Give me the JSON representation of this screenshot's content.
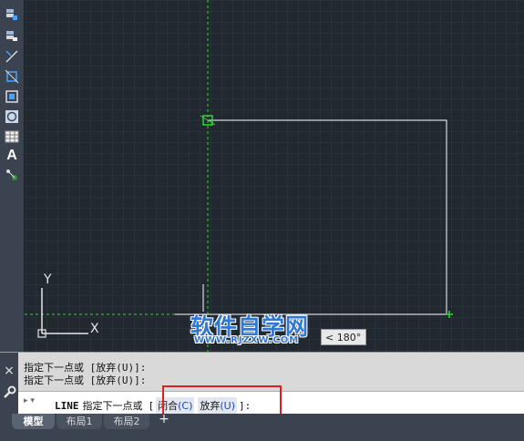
{
  "toolbar": {
    "tools": [
      {
        "icon": "layer-properties-icon"
      },
      {
        "icon": "layer-state-icon"
      },
      {
        "icon": "line-icon"
      },
      {
        "icon": "zoom-extents-icon"
      },
      {
        "icon": "zoom-window-icon"
      },
      {
        "icon": "circle-icon"
      },
      {
        "icon": "table-icon"
      },
      {
        "icon": "text-icon",
        "glyph": "A"
      },
      {
        "icon": "dimension-icon"
      }
    ]
  },
  "canvas": {
    "drawing_color": "#ffffff",
    "snap_color": "#2fd72f",
    "background": "#212830",
    "ucs_icon": "ucs-icon",
    "angle_tooltip": "< 180°"
  },
  "watermark": {
    "main": "软件自学网",
    "sub": "WWW.RJZXW.COM"
  },
  "command": {
    "history": [
      "指定下一点或 [放弃(U)]:",
      "指定下一点或 [放弃(U)]:"
    ],
    "close_icon": "×",
    "prompt_icon": "▸ ▾",
    "current": {
      "command": "LINE",
      "text": "指定下一点或",
      "open_bracket": "[",
      "close_bracket": "]:",
      "options": [
        {
          "label": "闭合",
          "key": "(C)"
        },
        {
          "label": "放弃",
          "key": "(U)"
        }
      ]
    },
    "highlight_color": "#e02020"
  },
  "tabs": {
    "model": "模型",
    "layout1": "布局1",
    "layout2": "布局2",
    "add": "+"
  }
}
